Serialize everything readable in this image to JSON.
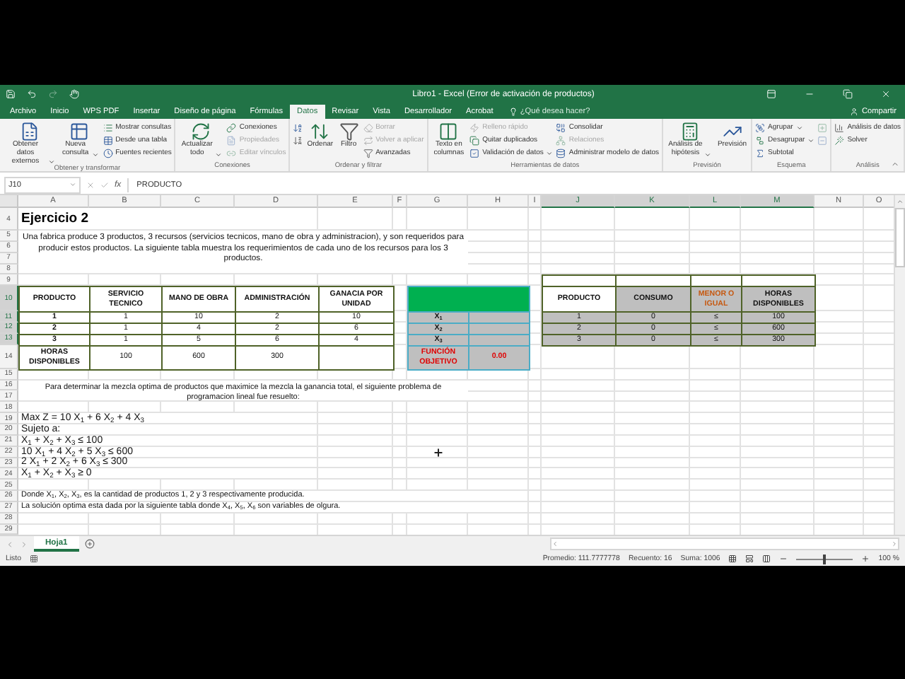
{
  "window": {
    "title": "Libro1 - Excel (Error de activación de productos)"
  },
  "ribbon_tabs": [
    {
      "label": "Archivo",
      "selected": false
    },
    {
      "label": "Inicio",
      "selected": false
    },
    {
      "label": "WPS PDF",
      "selected": false
    },
    {
      "label": "Insertar",
      "selected": false
    },
    {
      "label": "Diseño de página",
      "selected": false
    },
    {
      "label": "Fórmulas",
      "selected": false
    },
    {
      "label": "Datos",
      "selected": true
    },
    {
      "label": "Revisar",
      "selected": false
    },
    {
      "label": "Vista",
      "selected": false
    },
    {
      "label": "Desarrollador",
      "selected": false
    },
    {
      "label": "Acrobat",
      "selected": false
    }
  ],
  "tell_me": {
    "placeholder": "¿Qué desea hacer?"
  },
  "share": "Compartir",
  "ribbon_groups": [
    {
      "label": "Obtener y transformar",
      "items": [
        {
          "kind": "large",
          "label": "Obtener datos externos",
          "dropdown": true,
          "disabled": false
        },
        {
          "kind": "large",
          "label": "Nueva consulta",
          "dropdown": true,
          "disabled": false
        },
        {
          "kind": "small",
          "label": "Mostrar consultas",
          "dropdown": false,
          "disabled": false
        },
        {
          "kind": "small",
          "label": "Desde una tabla",
          "dropdown": false,
          "disabled": false
        },
        {
          "kind": "small",
          "label": "Fuentes recientes",
          "dropdown": false,
          "disabled": false
        }
      ]
    },
    {
      "label": "Conexiones",
      "items": [
        {
          "kind": "large",
          "label": "Actualizar todo",
          "dropdown": true,
          "disabled": false
        },
        {
          "kind": "small",
          "label": "Conexiones",
          "dropdown": false,
          "disabled": false
        },
        {
          "kind": "small",
          "label": "Propiedades",
          "dropdown": false,
          "disabled": true
        },
        {
          "kind": "small",
          "label": "Editar vínculos",
          "dropdown": false,
          "disabled": true
        }
      ]
    },
    {
      "label": "Ordenar y filtrar",
      "items": [
        {
          "kind": "icon",
          "disabled": false
        },
        {
          "kind": "icon",
          "disabled": false
        },
        {
          "kind": "large",
          "label": "Ordenar",
          "dropdown": false,
          "disabled": false
        },
        {
          "kind": "large",
          "label": "Filtro",
          "dropdown": false,
          "disabled": false
        },
        {
          "kind": "small",
          "label": "Borrar",
          "dropdown": false,
          "disabled": true
        },
        {
          "kind": "small",
          "label": "Volver a aplicar",
          "dropdown": false,
          "disabled": true
        },
        {
          "kind": "small",
          "label": "Avanzadas",
          "dropdown": false,
          "disabled": false
        }
      ]
    },
    {
      "label": "Herramientas de datos",
      "items": [
        {
          "kind": "large",
          "label": "Texto en columnas",
          "dropdown": false,
          "disabled": false
        },
        {
          "kind": "small",
          "label": "Relleno rápido",
          "dropdown": false,
          "disabled": true
        },
        {
          "kind": "small",
          "label": "Quitar duplicados",
          "dropdown": false,
          "disabled": false
        },
        {
          "kind": "small",
          "label": "Validación de datos",
          "dropdown": true,
          "disabled": false
        },
        {
          "kind": "small",
          "label": "Consolidar",
          "dropdown": false,
          "disabled": false
        },
        {
          "kind": "small",
          "label": "Relaciones",
          "dropdown": false,
          "disabled": true
        },
        {
          "kind": "small",
          "label": "Administrar modelo de datos",
          "dropdown": false,
          "disabled": false
        }
      ]
    },
    {
      "label": "Previsión",
      "items": [
        {
          "kind": "large",
          "label": "Análisis de hipótesis",
          "dropdown": true,
          "disabled": false
        },
        {
          "kind": "large",
          "label": "Previsión",
          "dropdown": false,
          "disabled": false
        }
      ]
    },
    {
      "label": "Esquema",
      "items": [
        {
          "kind": "small",
          "label": "Agrupar",
          "dropdown": true,
          "disabled": false
        },
        {
          "kind": "small",
          "label": "Desagrupar",
          "dropdown": true,
          "disabled": false
        },
        {
          "kind": "small",
          "label": "Subtotal",
          "dropdown": false,
          "disabled": false
        },
        {
          "kind": "icon",
          "disabled": true
        },
        {
          "kind": "icon",
          "disabled": true
        }
      ]
    },
    {
      "label": "Análisis",
      "items": [
        {
          "kind": "small",
          "label": "Análisis de datos",
          "dropdown": false,
          "disabled": false
        },
        {
          "kind": "small",
          "label": "Solver",
          "dropdown": false,
          "disabled": false
        }
      ]
    }
  ],
  "formula_bar": {
    "name_box": "J10",
    "function_label": "fx",
    "formula": "PRODUCTO"
  },
  "columns": [
    {
      "label": "A",
      "selected": false
    },
    {
      "label": "B",
      "selected": false
    },
    {
      "label": "C",
      "selected": false
    },
    {
      "label": "D",
      "selected": false
    },
    {
      "label": "E",
      "selected": false
    },
    {
      "label": "F",
      "selected": false
    },
    {
      "label": "G",
      "selected": false
    },
    {
      "label": "H",
      "selected": false
    },
    {
      "label": "I",
      "selected": false
    },
    {
      "label": "J",
      "selected": true
    },
    {
      "label": "K",
      "selected": true
    },
    {
      "label": "L",
      "selected": true
    },
    {
      "label": "M",
      "selected": true
    },
    {
      "label": "N",
      "selected": false
    },
    {
      "label": "O",
      "selected": false
    }
  ],
  "rows": [
    {
      "label": "4",
      "selected": false
    },
    {
      "label": "5",
      "selected": false
    },
    {
      "label": "6",
      "selected": false
    },
    {
      "label": "7",
      "selected": false
    },
    {
      "label": "8",
      "selected": false
    },
    {
      "label": "9",
      "selected": false
    },
    {
      "label": "10",
      "selected": true
    },
    {
      "label": "11",
      "selected": true
    },
    {
      "label": "12",
      "selected": true
    },
    {
      "label": "13",
      "selected": true
    },
    {
      "label": "14",
      "selected": false
    },
    {
      "label": "15",
      "selected": false
    },
    {
      "label": "16",
      "selected": false
    },
    {
      "label": "17",
      "selected": false
    },
    {
      "label": "18",
      "selected": false
    },
    {
      "label": "19",
      "selected": false
    },
    {
      "label": "20",
      "selected": false
    },
    {
      "label": "21",
      "selected": false
    },
    {
      "label": "22",
      "selected": false
    },
    {
      "label": "23",
      "selected": false
    },
    {
      "label": "24",
      "selected": false
    },
    {
      "label": "25",
      "selected": false
    },
    {
      "label": "26",
      "selected": false
    },
    {
      "label": "27",
      "selected": false
    },
    {
      "label": "28",
      "selected": false
    },
    {
      "label": "29",
      "selected": false
    }
  ],
  "sheet": {
    "title": "Ejercicio 2",
    "intro": "Una fabrica produce 3 productos, 3 recursos (servicios tecnicos, mano de obra y administracion), y son requeridos para producir estos productos. La siguiente tabla muestra los requerimientos de cada uno de los recursos para los 3 productos.",
    "table": {
      "columns": [
        "PRODUCTO",
        "SERVICIO TECNICO",
        "MANO DE OBRA",
        "ADMINISTRACIÓN",
        "GANACIA POR UNIDAD"
      ],
      "rows": [
        [
          "1",
          "1",
          "10",
          "2",
          "10"
        ],
        [
          "2",
          "1",
          "4",
          "2",
          "6"
        ],
        [
          "3",
          "1",
          "5",
          "6",
          "4"
        ],
        [
          "HORAS DISPONIBLES",
          "100",
          "600",
          "300"
        ]
      ]
    },
    "variables": [
      "X$_{1}$",
      "X$_{2}$",
      "X$_{3}$"
    ],
    "objective": {
      "label": "FUNCIÓN OBJETIVO",
      "value": "0.00"
    },
    "results": {
      "columns": [
        "PRODUCTO",
        "CONSUMO",
        "MENOR O IGUAL",
        "HORAS DISPONIBLES"
      ],
      "rows": [
        [
          "1",
          "0",
          "≤",
          "100"
        ],
        [
          "2",
          "0",
          "≤",
          "600"
        ],
        [
          "3",
          "0",
          "≤",
          "300"
        ]
      ]
    },
    "question": "Para determinar la mezcla optima de productos que maximice la mezcla la ganancia total, el siguiente problema de programacion lineal fue resuelto:",
    "model": [
      "Max Z = 10 X$_{1}$ + 6 X$_{2}$ + 4 X$_{3}$",
      "Sujeto a:",
      "X$_{1}$ + X$_{2}$ +  X$_{3}$ ≤ 100",
      "10 X$_{1}$ + 4 X$_{2}$ + 5 X$_{3}$ ≤ 600",
      "2 X$_{1}$ + 2 X$_{2}$ + 6 X$_{3}$ ≤ 300",
      "X$_{1}$ + X$_{2}$ +  X$_{3}$ ≥ 0"
    ],
    "notes": [
      "Donde X$_{1}$,  X$_{2}$,  X$_{3}$, es la cantidad de productos 1, 2 y 3 respectivamente producida.",
      "La solución optima esta dada por la siguiente tabla donde X$_{4}$,  X$_{5}$,  X$_{6}$ son variables de olgura."
    ]
  },
  "sheet_tabs": [
    {
      "label": "Hoja1",
      "selected": true
    }
  ],
  "status_bar": {
    "mode": "Listo",
    "average": "Promedio: 111.7777778",
    "count": "Recuento: 16",
    "sum": "Suma: 1006",
    "zoom": "100 %",
    "zoom_slider": {
      "level": 0.5
    }
  }
}
